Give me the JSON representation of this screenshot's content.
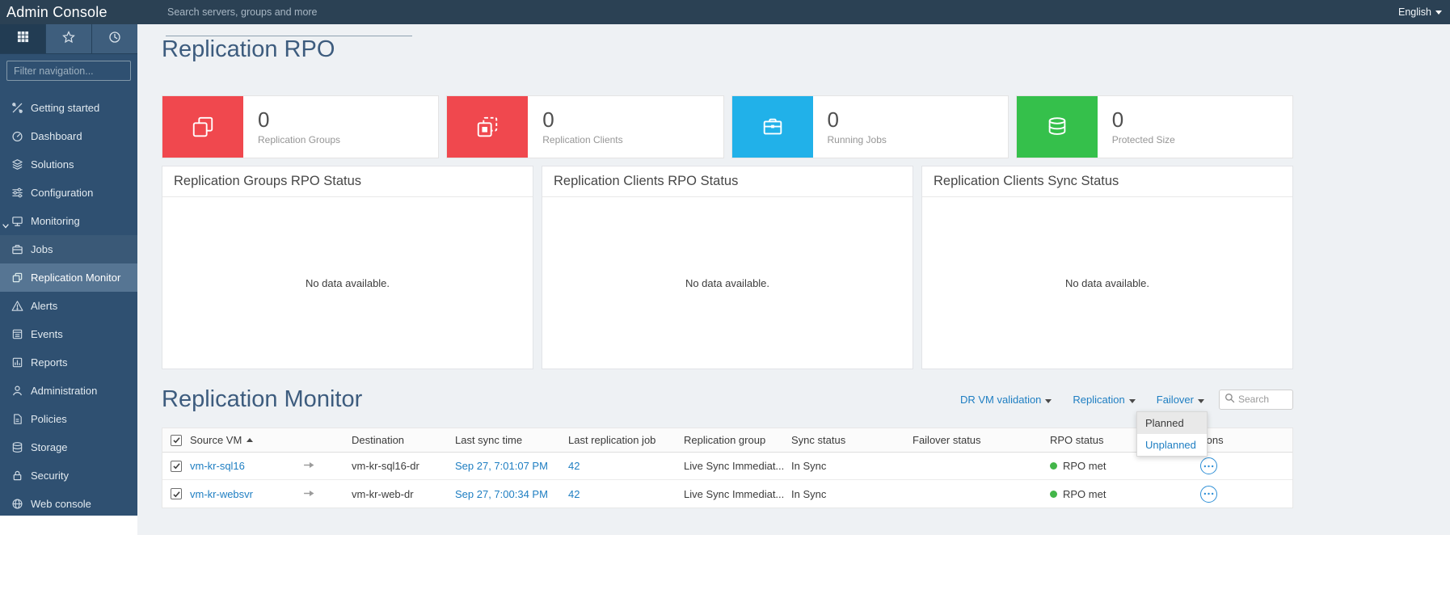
{
  "topbar": {
    "title": "Admin Console",
    "search_placeholder": "Search servers, groups and more",
    "language": "English"
  },
  "sidebar": {
    "filter_placeholder": "Filter navigation...",
    "items": [
      {
        "label": "Getting started",
        "icon": "tools-icon"
      },
      {
        "label": "Dashboard",
        "icon": "dashboard-icon"
      },
      {
        "label": "Solutions",
        "icon": "layers-icon"
      },
      {
        "label": "Configuration",
        "icon": "sliders-icon"
      },
      {
        "label": "Monitoring",
        "icon": "monitor-icon",
        "expanded": true
      },
      {
        "label": "Jobs",
        "icon": "briefcase-icon"
      },
      {
        "label": "Replication Monitor",
        "icon": "replication-icon",
        "selected": true
      },
      {
        "label": "Alerts",
        "icon": "alert-icon"
      },
      {
        "label": "Events",
        "icon": "events-icon"
      },
      {
        "label": "Reports",
        "icon": "reports-icon"
      },
      {
        "label": "Administration",
        "icon": "person-icon"
      },
      {
        "label": "Policies",
        "icon": "document-icon"
      },
      {
        "label": "Storage",
        "icon": "database-icon"
      },
      {
        "label": "Security",
        "icon": "lock-icon"
      },
      {
        "label": "Web console",
        "icon": "globe-icon"
      }
    ]
  },
  "page": {
    "title": "Replication RPO",
    "stats": [
      {
        "value": "0",
        "label": "Replication Groups",
        "color": "#f0484e",
        "icon": "replication-groups-icon"
      },
      {
        "value": "0",
        "label": "Replication Clients",
        "color": "#f0484e",
        "icon": "replication-clients-icon"
      },
      {
        "value": "0",
        "label": "Running Jobs",
        "color": "#21b1e9",
        "icon": "briefcase-icon"
      },
      {
        "value": "0",
        "label": "Protected Size",
        "color": "#35c04b",
        "icon": "database-icon"
      }
    ],
    "panels": [
      {
        "title": "Replication Groups RPO Status",
        "empty_text": "No data available."
      },
      {
        "title": "Replication Clients RPO Status",
        "empty_text": "No data available."
      },
      {
        "title": "Replication Clients Sync Status",
        "empty_text": "No data available."
      }
    ]
  },
  "monitor": {
    "title": "Replication Monitor",
    "actions": [
      {
        "label": "DR VM validation"
      },
      {
        "label": "Replication"
      },
      {
        "label": "Failover"
      }
    ],
    "search_placeholder": "Search",
    "dropdown": {
      "items": [
        {
          "label": "Planned"
        },
        {
          "label": "Unplanned"
        }
      ]
    },
    "rpo_dot_color": "#43b649",
    "table": {
      "columns": {
        "source": "Source VM",
        "destination": "Destination",
        "last_sync": "Last sync time",
        "last_job": "Last replication job",
        "group": "Replication group",
        "sync": "Sync status",
        "failover": "Failover status",
        "rpo": "RPO status",
        "actions": "Actions"
      },
      "rows": [
        {
          "source": "vm-kr-sql16",
          "destination": "vm-kr-sql16-dr",
          "last_sync": "Sep 27, 7:01:07 PM",
          "job": "42",
          "group": "Live Sync Immediat...",
          "sync_status": "In Sync",
          "failover_status": "",
          "rpo_status": "RPO met"
        },
        {
          "source": "vm-kr-websvr",
          "destination": "vm-kr-web-dr",
          "last_sync": "Sep 27, 7:00:34 PM",
          "job": "42",
          "group": "Live Sync Immediat...",
          "sync_status": "In Sync",
          "failover_status": "",
          "rpo_status": "RPO met"
        }
      ]
    }
  },
  "colors": {
    "accent_blue": "#1e7ec2",
    "topbar_bg": "#2b4154",
    "sidebar_bg": "#2f5071"
  }
}
